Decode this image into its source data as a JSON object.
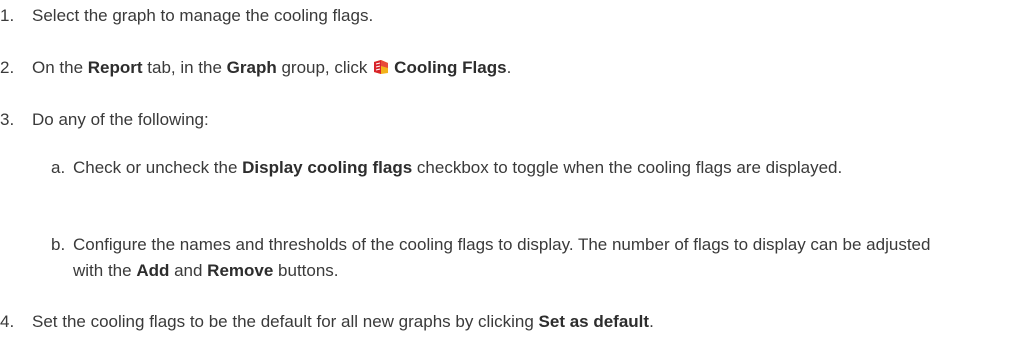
{
  "steps": [
    {
      "number": "1.",
      "text": "Select the graph to manage the cooling flags."
    },
    {
      "number": "2.",
      "parts": [
        "On the ",
        "Report",
        " tab, in the ",
        "Graph",
        " group, click ",
        "Cooling Flags",
        "."
      ],
      "icon": "cooling-flags-icon"
    },
    {
      "number": "3.",
      "text": "Do any of the following:",
      "substeps": [
        {
          "letter": "a.",
          "parts": [
            "Check or uncheck the ",
            "Display cooling flags",
            " checkbox to toggle when the cooling flags are displayed."
          ]
        },
        {
          "letter": "b.",
          "parts": [
            "Configure the names and thresholds of the cooling flags to display. The number of flags to display can be adjusted with the ",
            "Add",
            " and ",
            "Remove",
            " buttons."
          ]
        }
      ]
    },
    {
      "number": "4.",
      "parts": [
        "Set the cooling flags to be the default for all new graphs by clicking ",
        "Set as default",
        "."
      ]
    }
  ],
  "colors": {
    "text": "#3a3a3a",
    "icon_red": "#d8232a",
    "icon_yellow": "#f2b21b"
  }
}
